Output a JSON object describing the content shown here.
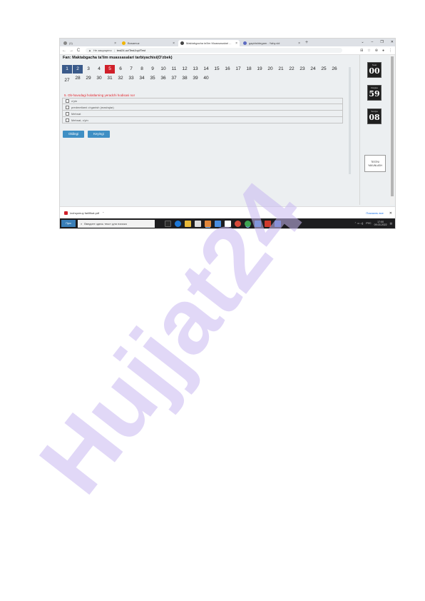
{
  "browser": {
    "tabs": [
      {
        "label": "(1)",
        "icon_color": "#888888",
        "active": false
      },
      {
        "label": "Bosamuz",
        "icon_color": "#f0b400",
        "active": false
      },
      {
        "label": "Maktabgacha ta'lim Muassasalari ...",
        "icon_color": "#444444",
        "active": true
      },
      {
        "label": "gapirishtegam - Yahy.vid",
        "icon_color": "#5c6bc0",
        "active": false
      }
    ],
    "new_tab": "+",
    "window_controls": [
      "⌄",
      "–",
      "❐",
      "✕"
    ],
    "nav": {
      "back": "←",
      "forward": "→",
      "reload": "C"
    },
    "url_secure_text": "Не защищено",
    "url_host": "test24.uz/TestJoyi/Test"
  },
  "page": {
    "title": "Fan: Maktabgacha ta'lim muassasalari tarbiyachisi(O'zbek)",
    "question_numbers": [
      {
        "n": "1",
        "state": "answered"
      },
      {
        "n": "2",
        "state": "answered"
      },
      {
        "n": "3",
        "state": "none"
      },
      {
        "n": "4",
        "state": "none"
      },
      {
        "n": "5",
        "state": "current"
      },
      {
        "n": "6",
        "state": "none"
      },
      {
        "n": "7",
        "state": "none"
      },
      {
        "n": "8",
        "state": "none"
      },
      {
        "n": "9",
        "state": "none"
      },
      {
        "n": "10",
        "state": "none"
      },
      {
        "n": "11",
        "state": "none"
      },
      {
        "n": "12",
        "state": "none"
      },
      {
        "n": "13",
        "state": "none"
      },
      {
        "n": "14",
        "state": "none"
      },
      {
        "n": "15",
        "state": "none"
      },
      {
        "n": "16",
        "state": "none"
      },
      {
        "n": "17",
        "state": "none"
      },
      {
        "n": "18",
        "state": "none"
      },
      {
        "n": "19",
        "state": "none"
      },
      {
        "n": "20",
        "state": "none"
      },
      {
        "n": "21",
        "state": "none"
      },
      {
        "n": "22",
        "state": "none"
      },
      {
        "n": "23",
        "state": "none"
      },
      {
        "n": "24",
        "state": "none"
      },
      {
        "n": "25",
        "state": "none"
      },
      {
        "n": "26",
        "state": "none"
      },
      {
        "n": "27",
        "state": "none"
      },
      {
        "n": "28",
        "state": "none"
      },
      {
        "n": "29",
        "state": "none"
      },
      {
        "n": "30",
        "state": "none"
      },
      {
        "n": "31",
        "state": "none"
      },
      {
        "n": "32",
        "state": "none"
      },
      {
        "n": "33",
        "state": "none"
      },
      {
        "n": "34",
        "state": "none"
      },
      {
        "n": "35",
        "state": "none"
      },
      {
        "n": "36",
        "state": "none"
      },
      {
        "n": "37",
        "state": "none"
      },
      {
        "n": "38",
        "state": "none"
      },
      {
        "n": "39",
        "state": "none"
      },
      {
        "n": "40",
        "state": "none"
      }
    ],
    "question": "5. Ob-havodagi holatlarning yeradchi hodisasi nor",
    "options": [
      "o'yin",
      "predmetlarni o'rganish (mashqlar)",
      "Mehnat",
      "Mehnat, o'yin"
    ],
    "buttons": {
      "prev": "Oldingi",
      "next": "Keyingi"
    },
    "timers": [
      {
        "label": "Soat",
        "value": "00"
      },
      {
        "label": "Daqiqa",
        "value": "59"
      },
      {
        "label": "Soniya",
        "value": "08"
      }
    ],
    "finish_button": {
      "line1": "TESTNI",
      "line2": "YAKUNLASH"
    }
  },
  "download_bar": {
    "file": "Izohqomuy farlifikat.pdf",
    "caret": "⌃",
    "show_all": "Показать все",
    "close": "✕"
  },
  "taskbar": {
    "start": "Пуск",
    "search_placeholder": "Введите здесь текст для поиска",
    "tray_lang": "РУС",
    "clock_time": "17:00",
    "clock_date": "09.03.2022"
  },
  "watermark": {
    "text": "Hujjat24",
    "color": "#c9b8f0"
  }
}
